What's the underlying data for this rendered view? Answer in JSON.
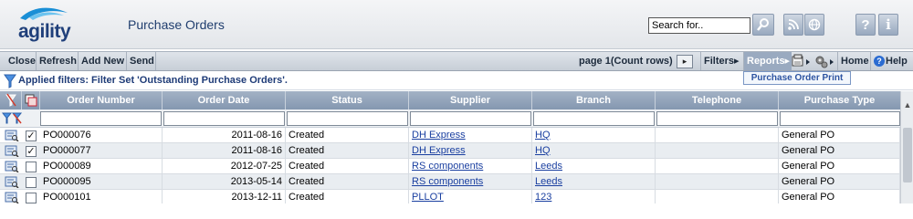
{
  "header": {
    "logo_text": "agility",
    "title": "Purchase Orders",
    "search_placeholder": "Search for..",
    "help_label": "?",
    "info_label": "i"
  },
  "toolbar": {
    "close": "Close",
    "refresh": "Refresh",
    "add_new": "Add New",
    "send": "Send",
    "page_info": "page 1(Count rows)",
    "next": "▸",
    "filters": "Filters▸",
    "reports": "Reports▸",
    "home": "Home",
    "help": "Help",
    "reports_dropdown": "Purchase Order Print"
  },
  "filter_bar": {
    "text": "Applied filters: Filter Set 'Outstanding Purchase Orders'."
  },
  "grid": {
    "columns": [
      "Order Number",
      "Order Date",
      "Status",
      "Supplier",
      "Branch",
      "Telephone",
      "Purchase Type"
    ],
    "rows": [
      {
        "checked": true,
        "order_number": "PO000076",
        "order_date": "2011-08-16",
        "status": "Created",
        "supplier": "DH Express",
        "branch": "HQ",
        "telephone": "",
        "purchase_type": "General PO"
      },
      {
        "checked": true,
        "order_number": "PO000077",
        "order_date": "2011-08-16",
        "status": "Created",
        "supplier": "DH Express",
        "branch": "HQ",
        "telephone": "",
        "purchase_type": "General PO"
      },
      {
        "checked": false,
        "order_number": "PO000089",
        "order_date": "2012-07-25",
        "status": "Created",
        "supplier": "RS components",
        "branch": "Leeds",
        "telephone": "",
        "purchase_type": "General PO"
      },
      {
        "checked": false,
        "order_number": "PO000095",
        "order_date": "2013-05-14",
        "status": "Created",
        "supplier": "RS components",
        "branch": "Leeds",
        "telephone": "",
        "purchase_type": "General PO"
      },
      {
        "checked": false,
        "order_number": "PO000101",
        "order_date": "2013-12-11",
        "status": "Created",
        "supplier": "PLLOT",
        "branch": "123",
        "telephone": "",
        "purchase_type": "General PO"
      }
    ]
  },
  "colors": {
    "header_bg": "#e3e6ea",
    "title": "#1f3d6e",
    "grid_header": "#8497b0",
    "link": "#1a3fa0",
    "alt_row": "#e9edf1"
  },
  "icons": [
    "search-icon",
    "rss-icon",
    "globe-icon",
    "help-icon",
    "info-icon",
    "filter-icon",
    "export-icon",
    "settings-icon",
    "view-record-icon"
  ]
}
